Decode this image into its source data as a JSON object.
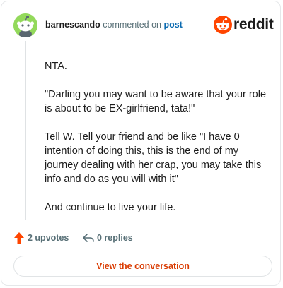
{
  "header": {
    "username": "barnescando",
    "action_text": "commented on",
    "post_link": "post",
    "avatar_icon": "snoo-avatar-icon",
    "brand_icon": "reddit-logo-icon",
    "brand_name": "reddit"
  },
  "comment": {
    "paragraphs": [
      "NTA.",
      "\"Darling you may want to be aware that your role is about to be EX-girlfriend, tata!\"",
      "Tell W. Tell your friend and be like \"I have 0 intention of doing this, this is the end of my journey dealing with her crap, you may take this info and do as you will with it\"",
      "And continue to live your life."
    ]
  },
  "actions": {
    "upvotes_label": "2 upvotes",
    "upvote_icon": "upvote-arrow-icon",
    "replies_label": "0 replies",
    "reply_icon": "reply-icon"
  },
  "cta": {
    "label": "View the conversation"
  },
  "colors": {
    "accent": "#d93a00",
    "upvote": "#ff4500",
    "link": "#0a6ab0",
    "avatar_bg": "#93d95b",
    "muted": "#576f76"
  }
}
